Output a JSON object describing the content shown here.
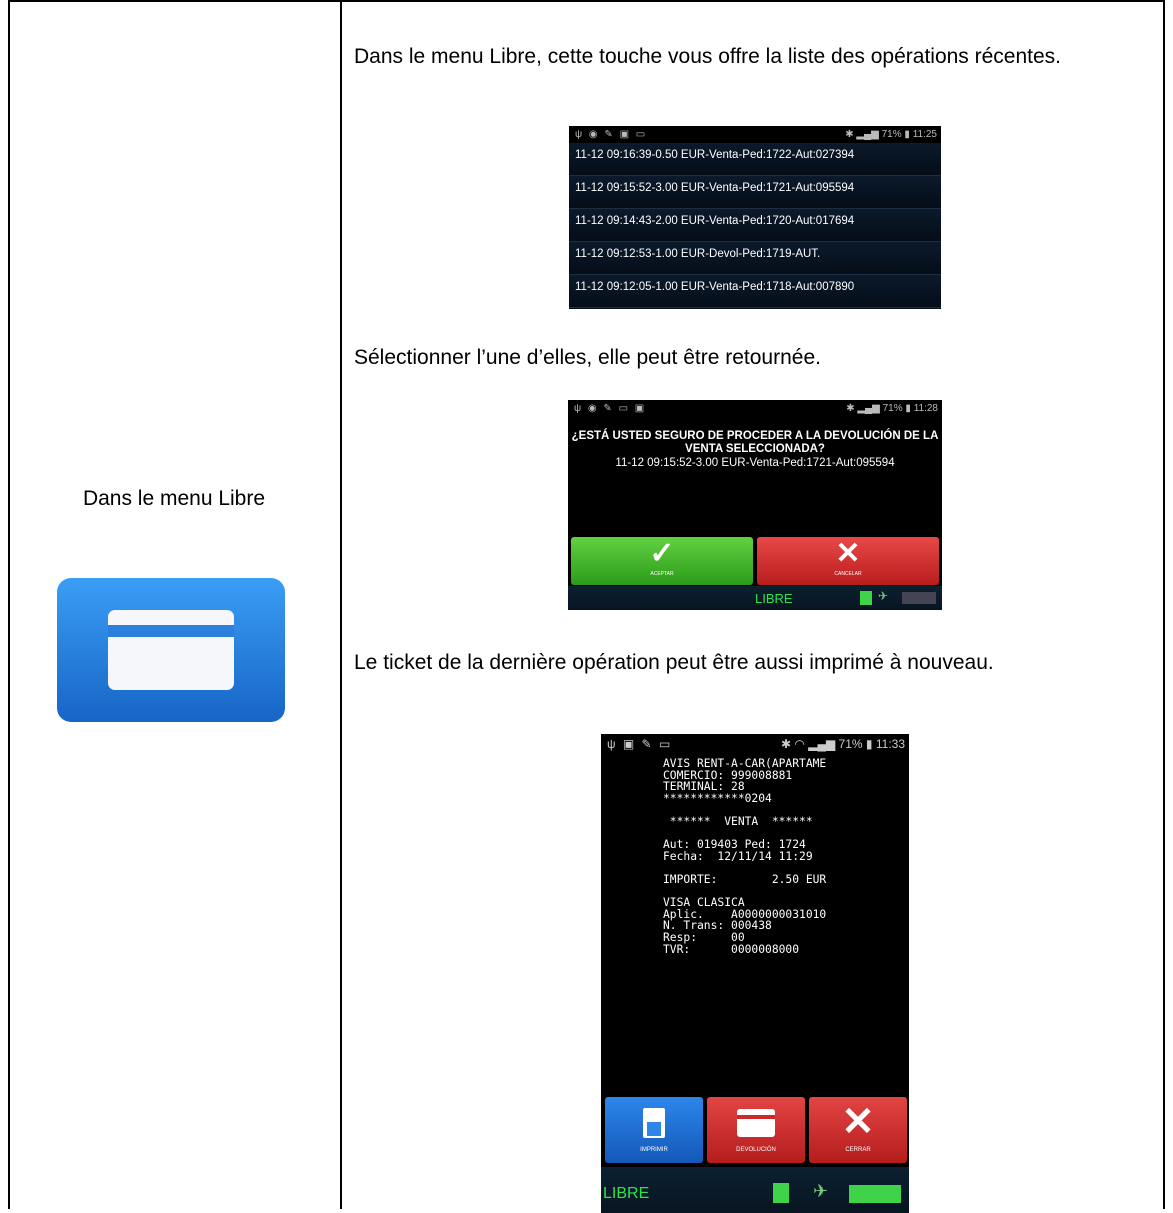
{
  "left_column": {
    "label": "Dans le menu Libre"
  },
  "right_column": {
    "para1": "Dans le menu Libre, cette touche vous offre la liste des opérations récentes.",
    "para2": "Sélectionner l’une d’elles, elle peut être retournée.",
    "para3": "Le ticket de la dernière opération peut être aussi imprimé à nouveau."
  },
  "screen1": {
    "status_time": "11:25",
    "status_battery": "71%",
    "operations": [
      "11-12 09:16:39-0.50 EUR-Venta-Ped:1722-Aut:027394",
      "11-12 09:15:52-3.00 EUR-Venta-Ped:1721-Aut:095594",
      "11-12 09:14:43-2.00 EUR-Venta-Ped:1720-Aut:017694",
      "11-12 09:12:53-1.00 EUR-Devol-Ped:1719-AUT.",
      "11-12 09:12:05-1.00 EUR-Venta-Ped:1718-Aut:007890"
    ]
  },
  "screen2": {
    "status_time": "11:28",
    "status_battery": "71%",
    "question": "¿ESTÁ USTED SEGURO DE PROCEDER A LA DEVOLUCIÓN DE LA VENTA SELECCIONADA?",
    "selected": "11-12 09:15:52-3.00 EUR-Venta-Ped:1721-Aut:095594",
    "accept_label": "ACEPTAR",
    "cancel_label": "CANCELAR",
    "mode": "LIBRE"
  },
  "screen3": {
    "status_time": "11:33",
    "status_battery": "71%",
    "receipt": "AVIS RENT-A-CAR(APARTAME\nCOMERCIO: 999008881\nTERMINAL: 28\n************0204\n\n ******  VENTA  ******\n\nAut: 019403 Ped: 1724\nFecha:  12/11/14 11:29\n\nIMPORTE:        2.50 EUR\n\nVISA CLASICA\nAplic.    A0000000031010\nN. Trans: 000438\nResp:     00\nTVR:      0000008000",
    "print_label": "IMPRIMIR",
    "refund_label": "DEVOLUCIÓN",
    "close_label": "CERRAR",
    "mode": "LIBRE"
  },
  "colors": {
    "accept": "#3dbb24",
    "cancel": "#d62e2e",
    "print": "#1f6fd6",
    "status_green": "#2fe34a"
  }
}
